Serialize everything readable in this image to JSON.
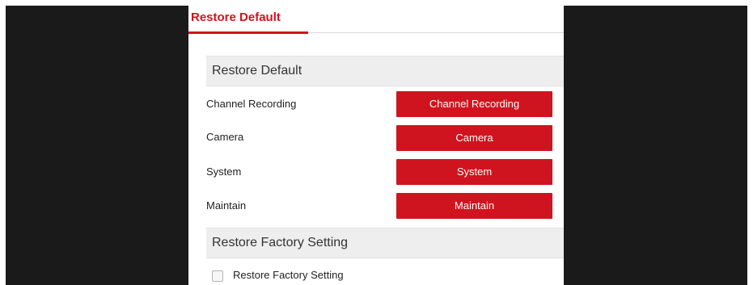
{
  "tab": {
    "label": "Restore Default"
  },
  "sections": {
    "restore_default": {
      "title": "Restore Default"
    },
    "restore_factory": {
      "title": "Restore Factory Setting"
    }
  },
  "rows": [
    {
      "label": "Channel Recording",
      "button": "Channel Recording"
    },
    {
      "label": "Camera",
      "button": "Camera"
    },
    {
      "label": "System",
      "button": "System"
    },
    {
      "label": "Maintain",
      "button": "Maintain"
    }
  ],
  "factory_checkbox": {
    "label": "Restore Factory Setting",
    "checked": false
  },
  "colors": {
    "accent": "#d0141f",
    "letterbox": "#1a1a1a",
    "section_bg": "#eeeeee"
  }
}
